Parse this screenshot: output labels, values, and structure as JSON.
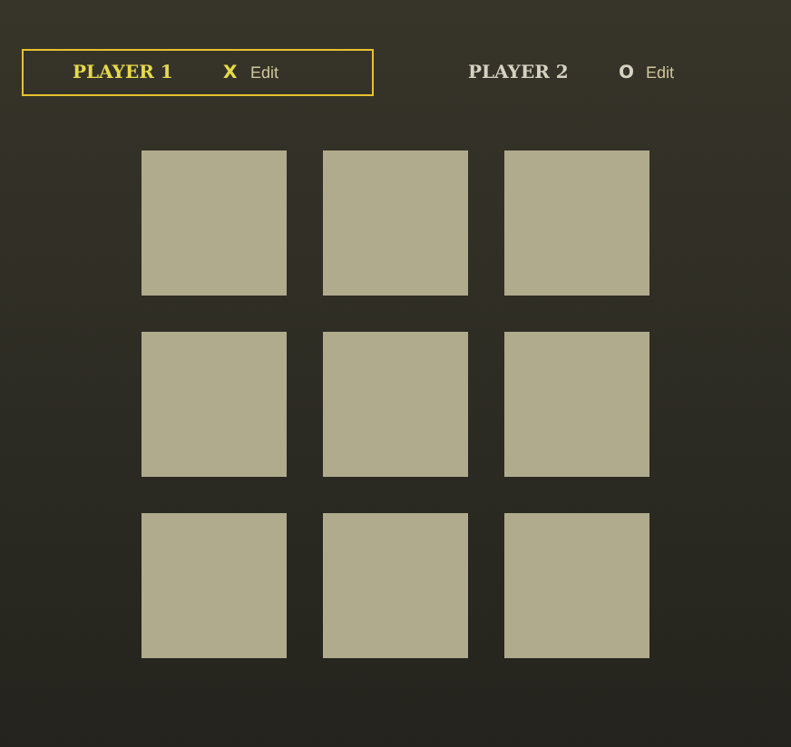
{
  "players": [
    {
      "name": "PLAYER 1",
      "symbol": "X",
      "edit": "Edit",
      "selected": true
    },
    {
      "name": "PLAYER 2",
      "symbol": "O",
      "edit": "Edit",
      "selected": false
    }
  ],
  "board": {
    "cells": [
      {
        "kind": "empty"
      },
      {
        "kind": "empty"
      },
      {
        "kind": "empty"
      },
      {
        "kind": "empty"
      },
      {
        "kind": "empty"
      },
      {
        "kind": "empty"
      },
      {
        "kind": "empty"
      },
      {
        "kind": "empty"
      },
      {
        "kind": "empty"
      }
    ]
  }
}
